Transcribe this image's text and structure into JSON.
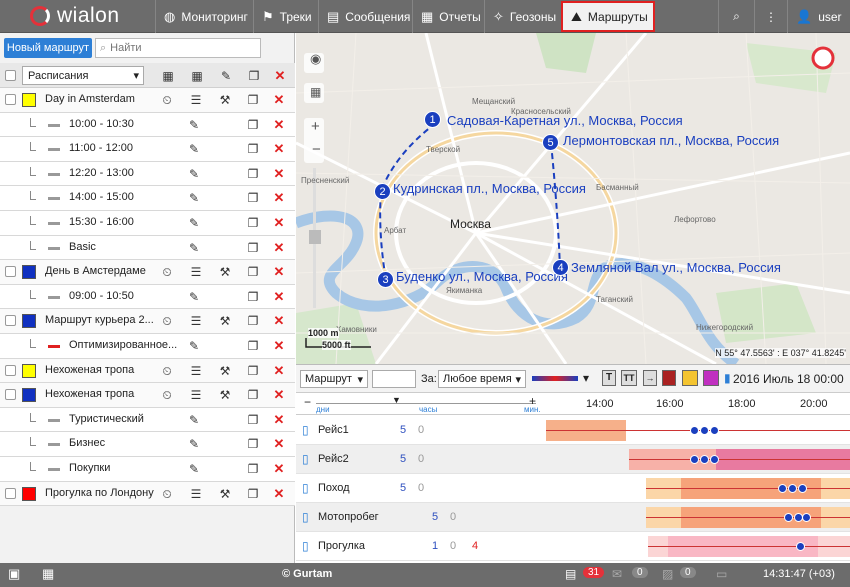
{
  "topbar": {
    "logo_text": "wialon",
    "nav": [
      "Мониторинг",
      "Треки",
      "Сообщения",
      "Отчеты",
      "Геозоны",
      "Маршруты"
    ],
    "user": "user"
  },
  "left": {
    "new_route_label": "Новый маршрут",
    "search_placeholder": "Найти",
    "schedule_select": "Расписания",
    "rows": [
      {
        "type": "route",
        "label": "Day in Amsterdam",
        "color": "#ffff00"
      },
      {
        "type": "sched",
        "label": "10:00 - 10:30"
      },
      {
        "type": "sched",
        "label": "11:00 - 12:00"
      },
      {
        "type": "sched",
        "label": "12:20 - 13:00"
      },
      {
        "type": "sched",
        "label": "14:00 - 15:00"
      },
      {
        "type": "sched",
        "label": "15:30 - 16:00"
      },
      {
        "type": "sched",
        "label": "Basic"
      },
      {
        "type": "route",
        "label": "День в Амстердаме",
        "color": "#1030c0"
      },
      {
        "type": "sched",
        "label": "09:00 - 10:50"
      },
      {
        "type": "route",
        "label": "Маршрут курьера 2...",
        "color": "#1030c0"
      },
      {
        "type": "sched",
        "label": "Оптимизированное...",
        "dash": "#e02020"
      },
      {
        "type": "route",
        "label": "Нехоженая тропа",
        "color": "#ffff00"
      },
      {
        "type": "route",
        "label": "Нехоженая тропа",
        "color": "#1030c0"
      },
      {
        "type": "sched",
        "label": "Туристический"
      },
      {
        "type": "sched",
        "label": "Бизнес"
      },
      {
        "type": "sched",
        "label": "Покупки"
      },
      {
        "type": "route",
        "label": "Прогулка по Лондону",
        "color": "#ff0000"
      }
    ]
  },
  "map": {
    "city": "Москва",
    "points": [
      {
        "n": "1",
        "label": "Садовая-Каретная ул., Москва, Россия"
      },
      {
        "n": "2",
        "label": "Кудринская пл., Москва, Россия"
      },
      {
        "n": "3",
        "label": "Буденко ул., Москва, Россия"
      },
      {
        "n": "4",
        "label": "Земляной Вал ул., Москва, Россия"
      },
      {
        "n": "5",
        "label": "Лермонтовская пл., Москва, Россия"
      }
    ],
    "scale_m": "1000 m",
    "scale_ft": "5000 ft",
    "coords": "N 55° 47.5563' : E 037° 41.8245'",
    "districts": [
      "Мещанский",
      "Красносельский",
      "Тверской",
      "Пресненский",
      "Арбат",
      "Якиманка",
      "Басманный",
      "Лефортово",
      "Таганский",
      "Нижегородский",
      "Хамовники"
    ]
  },
  "timeline": {
    "route_select": "Маршрут",
    "za_label": "За:",
    "period_select": "Любое время",
    "date": "2016 Июль 18 00:00",
    "scale_labels": [
      "дни",
      "часы",
      "мин."
    ],
    "hours": [
      "14:00",
      "16:00",
      "18:00",
      "20:00"
    ],
    "rows": [
      {
        "name": "Рейс1",
        "a": "5",
        "b": "0",
        "c": ""
      },
      {
        "name": "Рейс2",
        "a": "5",
        "b": "0",
        "c": ""
      },
      {
        "name": "Поход",
        "a": "5",
        "b": "0",
        "c": ""
      },
      {
        "name": "Мотопробег",
        "a": "5",
        "b": "0",
        "c": ""
      },
      {
        "name": "Прогулка",
        "a": "1",
        "b": "0",
        "c": "4"
      }
    ]
  },
  "status": {
    "copyright": "© Gurtam",
    "notif": "31",
    "mail": "0",
    "photo": "0",
    "time": "14:31:47 (+03)"
  },
  "colors": {
    "accent": "#2d7fd6",
    "highlight": "#e02020",
    "topbar": "#6c6c6c",
    "route_line": "#1a3fbf"
  }
}
